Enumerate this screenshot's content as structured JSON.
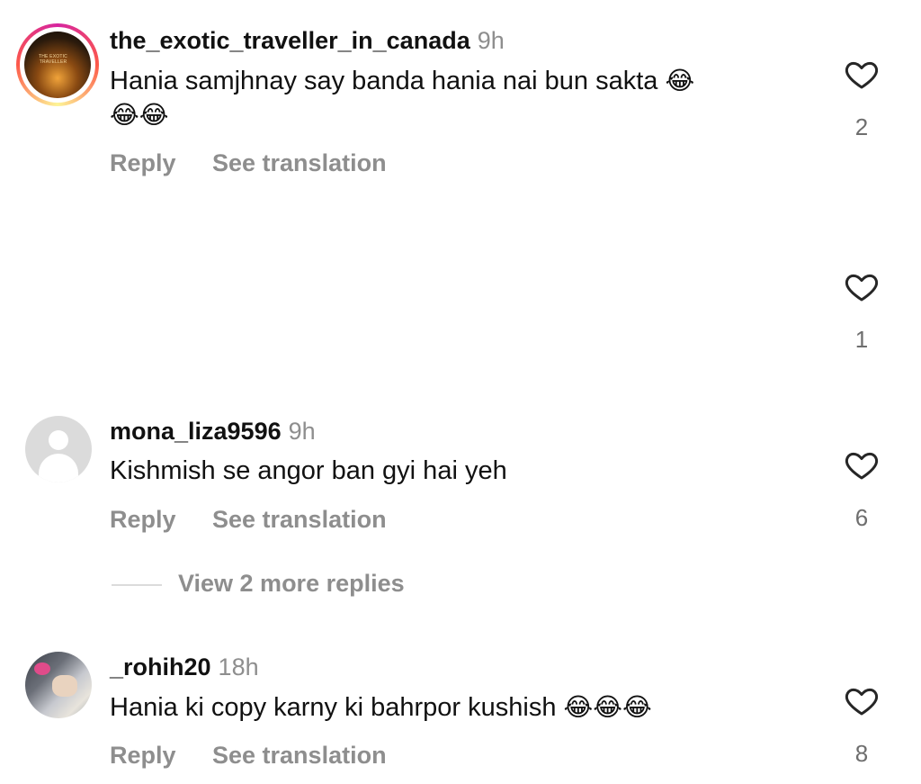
{
  "comments": [
    {
      "username": "the_exotic_traveller_in_canada",
      "time": "9h",
      "avatar_text": "THE EXOTIC TRAVELLER",
      "text_line1": "Hania samjhnay say banda hania nai bun sakta",
      "text_line2": "",
      "emoji": "😂",
      "likes": "2",
      "reply_label": "Reply",
      "translate_label": "See translation"
    },
    {
      "likes": "1"
    },
    {
      "username": "mona_liza9596",
      "time": "9h",
      "text_line1": "Kishmish se angor ban gyi hai yeh",
      "likes": "6",
      "reply_label": "Reply",
      "translate_label": "See translation",
      "view_replies": "View 2 more replies"
    },
    {
      "username": "_rohih20",
      "time": "18h",
      "text_line1": "Hania ki copy karny ki bahrpor kushish",
      "emoji": "😂",
      "likes": "8",
      "reply_label": "Reply",
      "translate_label": "See translation"
    }
  ],
  "colors": {
    "username": "#111111",
    "meta_gray": "#8e8e8e",
    "heart_stroke": "#262626",
    "story_ring": "#d6249f"
  },
  "icons": [
    "heart-icon",
    "default-avatar-icon"
  ]
}
